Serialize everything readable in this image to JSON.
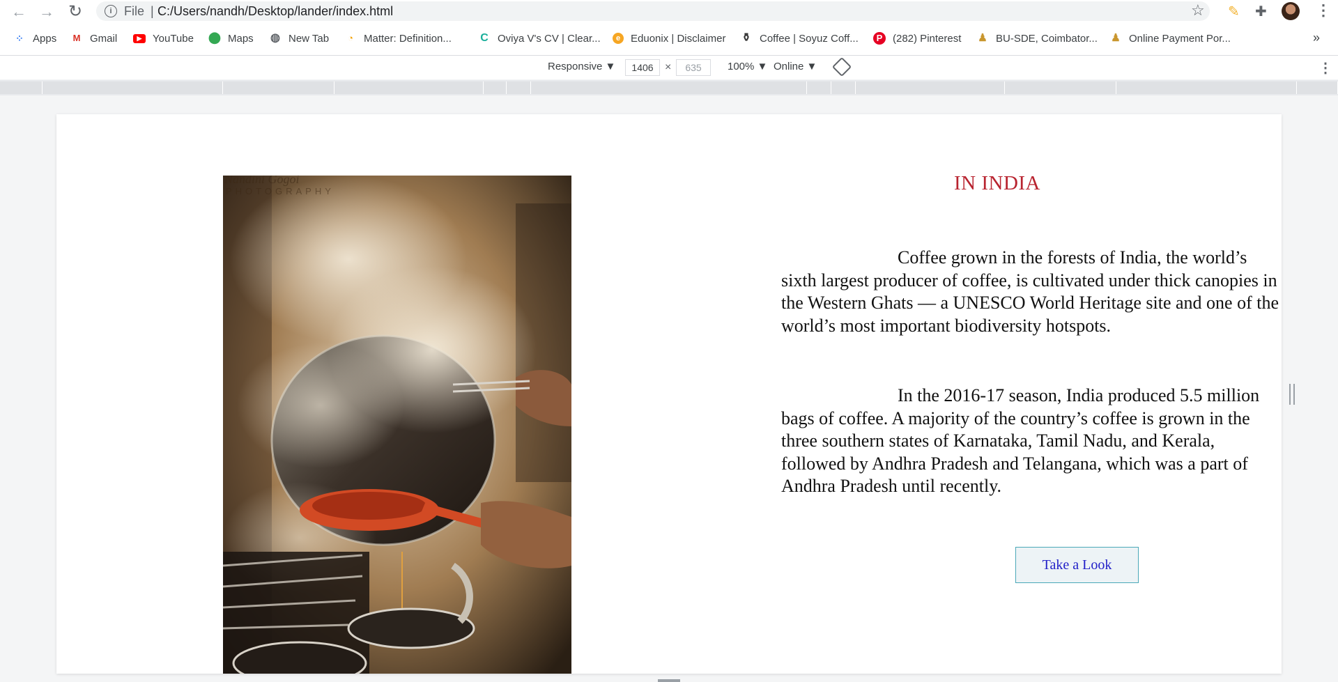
{
  "browser": {
    "omnibox": {
      "scheme_label": "File",
      "separator": "|",
      "url": "C:/Users/nandh/Desktop/lander/index.html"
    },
    "bookmarks": [
      {
        "label": "Apps",
        "icon": "apps-grid-icon"
      },
      {
        "label": "Gmail",
        "icon": "gmail-icon"
      },
      {
        "label": "YouTube",
        "icon": "youtube-icon"
      },
      {
        "label": "Maps",
        "icon": "maps-pin-icon"
      },
      {
        "label": "New Tab",
        "icon": "globe-icon"
      },
      {
        "label": "Matter: Definition...",
        "icon": "matter-icon"
      },
      {
        "label": "Oviya V's CV | Clear...",
        "icon": "cv-icon"
      },
      {
        "label": "Eduonix | Disclaimer",
        "icon": "eduonix-icon"
      },
      {
        "label": "Coffee | Soyuz Coff...",
        "icon": "coffee-icon"
      },
      {
        "label": "(282) Pinterest",
        "icon": "pinterest-icon"
      },
      {
        "label": "BU-SDE, Coimbator...",
        "icon": "person-icon"
      },
      {
        "label": "Online Payment Por...",
        "icon": "person-icon"
      }
    ],
    "bookmarks_overflow": "»"
  },
  "devtools": {
    "device": "Responsive ▼",
    "width": "1406",
    "height": "635",
    "times": "×",
    "zoom": "100% ▼",
    "network": "Online ▼"
  },
  "page": {
    "image_watermark_line1": "Nandini Gogoi",
    "image_watermark_line2": "PHOTOGRAPHY",
    "heading": "IN INDIA",
    "paragraph1": "Coffee grown in the forests of India, the world’s sixth largest producer of coffee, is cultivated under thick canopies in the Western Ghats — a UNESCO World Heritage site and one of the world’s most important biodiversity hotspots.",
    "paragraph2": "In the 2016-17 season, India produced 5.5 million bags of coffee. A majority of the country’s coffee is grown in the three southern states of Karnataka, Tamil Nadu, and Kerala, followed by Andhra Pradesh and Telangana, which was a part of Andhra Pradesh until recently.",
    "cta_label": "Take a Look",
    "colors": {
      "heading": "#b8232f",
      "cta_text": "#2220c8",
      "cta_border": "#4aa8b8"
    }
  }
}
